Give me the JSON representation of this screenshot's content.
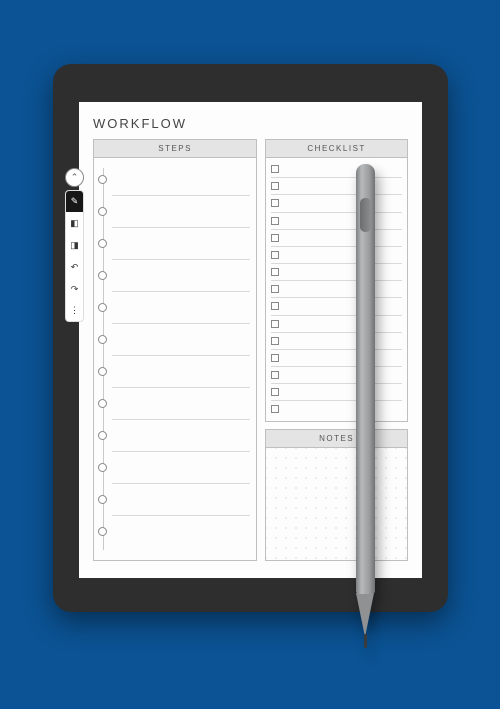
{
  "title": "WORKFLOW",
  "sections": {
    "steps_label": "STEPS",
    "checklist_label": "CHECKLIST",
    "notes_label": "NOTES"
  },
  "steps_count": 12,
  "checklist_count": 15,
  "toolbar": {
    "collapse_glyph": "⌃",
    "items": [
      {
        "name": "pen-tool",
        "glyph": "✎",
        "selected": true
      },
      {
        "name": "highlighter-tool",
        "glyph": "◧",
        "selected": false
      },
      {
        "name": "eraser-tool",
        "glyph": "◨",
        "selected": false
      },
      {
        "name": "undo-tool",
        "glyph": "↶",
        "selected": false
      },
      {
        "name": "redo-tool",
        "glyph": "↷",
        "selected": false
      },
      {
        "name": "more-tool",
        "glyph": "⋮",
        "selected": false
      }
    ]
  }
}
